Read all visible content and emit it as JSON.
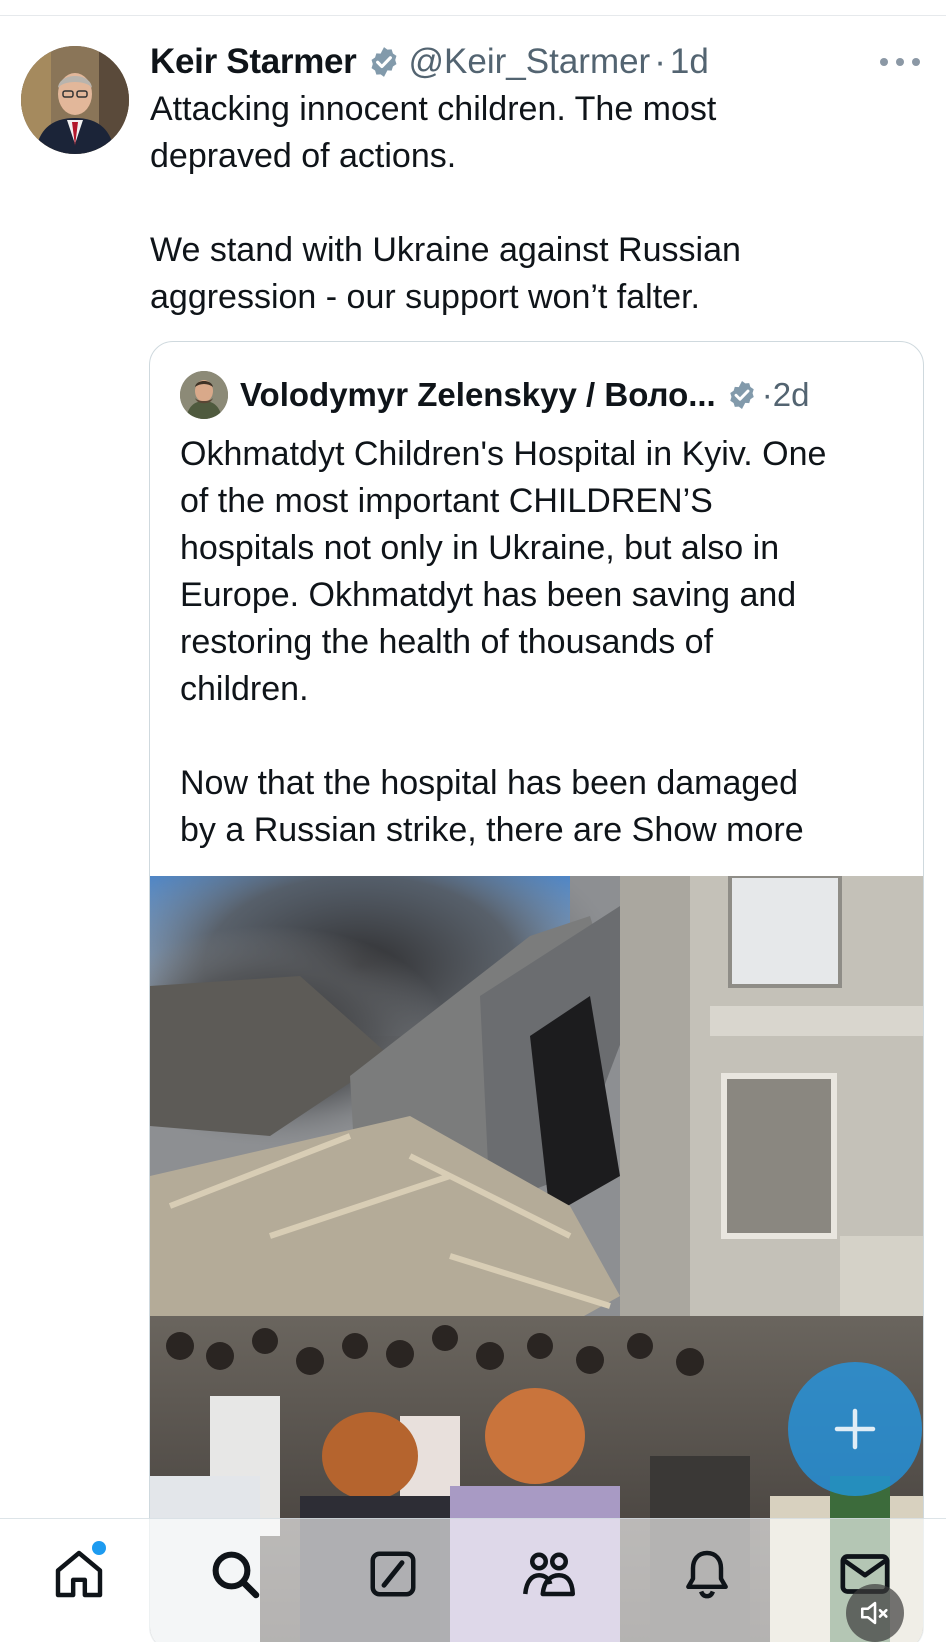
{
  "post": {
    "author_name": "Keir Starmer",
    "handle": "@Keir_Starmer",
    "separator": "·",
    "time": "1d",
    "text": "Attacking innocent children. The most\ndepraved of actions.\n\nWe stand with Ukraine against Russian\naggression - our support won’t falter."
  },
  "quote": {
    "author_name": "Volodymyr Zelenskyy / Воло...",
    "separator": "·",
    "time": "2d",
    "text": "Okhmatdyt Children's Hospital in Kyiv. One\nof the most important CHILDREN’S\nhospitals not only in Ukraine, but also in\nEurope. Okhmatdyt has been saving and\nrestoring the health of thousands of\nchildren.\n\nNow that the hospital has been damaged\nby a Russian strike, there are ",
    "show_more_label": "Show more"
  },
  "icons": {
    "verified": "verified-badge-icon",
    "more": "more-horizontal-icon",
    "compose": "plus-icon",
    "nav": [
      "home-icon",
      "search-icon",
      "grok-icon",
      "communities-icon",
      "notifications-icon",
      "messages-icon"
    ],
    "mute": "muted-speaker-icon"
  },
  "colors": {
    "accent": "#1d9bf0",
    "text_primary": "#0f1419",
    "text_secondary": "#536471",
    "border": "#cfd9de"
  }
}
